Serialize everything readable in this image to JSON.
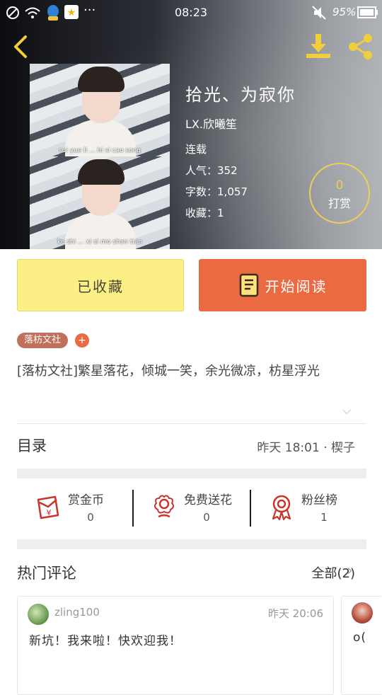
{
  "status_bar": {
    "time": "08:23",
    "battery": "95%"
  },
  "book": {
    "title": "拾光、为寂你",
    "author": "LX.欣曦笙",
    "status": "连载",
    "popularity_label": "人气：",
    "popularity": "352",
    "word_count_label": "字数：",
    "word_count": "1,057",
    "favorites_label": "收藏：",
    "favorites": "1",
    "cover_captions": [
      "sui yue li ... hi si cao song",
      "ke shi ... xi si mo shan tian"
    ]
  },
  "tip": {
    "count": "0",
    "label": "打赏"
  },
  "actions": {
    "favorited_label": "已收藏",
    "read_label": "开始阅读"
  },
  "tags": {
    "publisher": "落枋文社",
    "add": "+"
  },
  "summary": "[落枋文社]繁星落花，倾城一笑，余光微凉，枋星浮光",
  "toc": {
    "label": "目录",
    "latest": "昨天 18:01 · 楔子"
  },
  "stats": [
    {
      "label": "赏金币",
      "value": "0"
    },
    {
      "label": "免费送花",
      "value": "0"
    },
    {
      "label": "粉丝榜",
      "value": "1"
    }
  ],
  "hot_comments": {
    "label": "热门评论",
    "all_label": "全部(2)"
  },
  "comments": [
    {
      "user": "zling100",
      "time": "昨天 20:06",
      "text": "新坑！我来啦！快欢迎我！"
    },
    {
      "user": "",
      "time": "",
      "text": "o("
    }
  ],
  "colors": {
    "accent_orange": "#ea6a42",
    "favorited_yellow": "#fbef86",
    "tip_gold": "#f4c94b",
    "tag_brown": "#c0705c"
  }
}
